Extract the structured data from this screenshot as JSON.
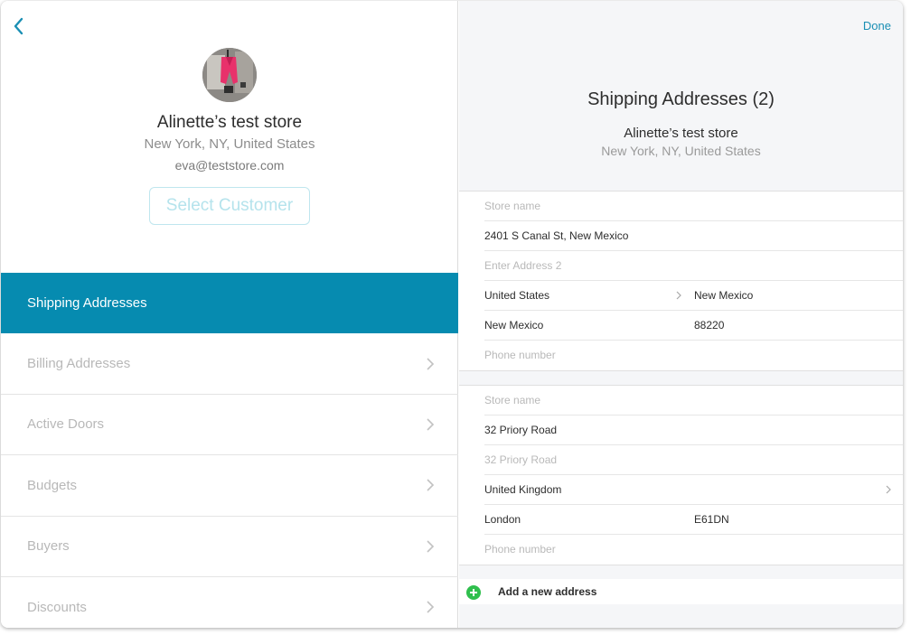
{
  "nav": {
    "back_icon": "chevron-left-icon",
    "done_label": "Done"
  },
  "customer": {
    "name": "Alinette’s test store",
    "location": "New York, NY, United States",
    "email": "eva@teststore.com",
    "select_label": "Select Customer"
  },
  "menu": {
    "items": [
      {
        "label": "Shipping Addresses",
        "active": true
      },
      {
        "label": "Billing Addresses"
      },
      {
        "label": "Active Doors"
      },
      {
        "label": "Budgets"
      },
      {
        "label": "Buyers"
      },
      {
        "label": "Discounts"
      }
    ]
  },
  "detail": {
    "title": "Shipping Addresses (2)",
    "store_name": "Alinette’s test store",
    "location": "New York, NY, United States",
    "addresses": [
      {
        "store_name_placeholder": "Store name",
        "address1": "2401 S Canal St, New Mexico",
        "address2_placeholder": "Enter Address 2",
        "country": "United States",
        "state": "New Mexico",
        "city": "New Mexico",
        "zip": "88220",
        "phone_placeholder": "Phone number"
      },
      {
        "store_name_placeholder": "Store name",
        "address1": "32 Priory Road",
        "address2_placeholder": "32 Priory Road",
        "country": "United Kingdom",
        "city": "London",
        "zip": "E61DN",
        "phone_placeholder": "Phone number"
      }
    ],
    "add_label": "Add a new address"
  },
  "colors": {
    "accent": "#068bb0",
    "link": "#1a8fb4",
    "add": "#2fbf4d"
  }
}
